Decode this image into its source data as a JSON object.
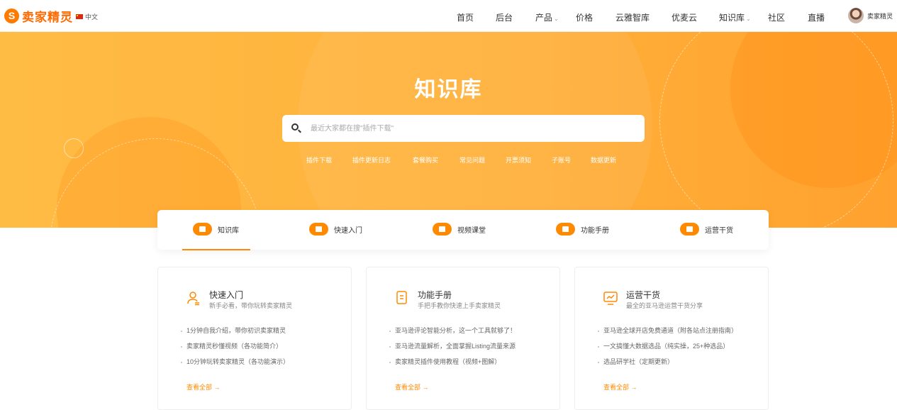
{
  "brand": {
    "logo_mark": "S",
    "name": "卖家精灵",
    "color": "#ff6a00"
  },
  "lang": {
    "label": "中文"
  },
  "nav": {
    "home": "首页",
    "backend": "后台",
    "product": "产品",
    "price": "价格",
    "yunya": "云雅智库",
    "youmai": "优麦云",
    "knowledge": "知识库",
    "community": "社区",
    "live": "直播"
  },
  "user": {
    "name": "卖家精灵"
  },
  "hero": {
    "title": "知识库",
    "search_placeholder": "最近大家都在搜\"插件下载\"",
    "hot_links": [
      "插件下载",
      "插件更新日志",
      "套餐购买",
      "常见问题",
      "开票须知",
      "子账号",
      "数据更新"
    ]
  },
  "tabs": [
    {
      "label": "知识库",
      "icon": "folder-icon"
    },
    {
      "label": "快速入门",
      "icon": "user-icon"
    },
    {
      "label": "视频课堂",
      "icon": "video-icon"
    },
    {
      "label": "功能手册",
      "icon": "document-icon"
    },
    {
      "label": "运营干货",
      "icon": "briefcase-icon"
    }
  ],
  "cards": [
    {
      "title": "快速入门",
      "subtitle": "新手必看，带你玩转卖家精灵",
      "items": [
        "1分钟自我介绍，带你初识卖家精灵",
        "卖家精灵秒懂视频（各功能简介）",
        "10分钟玩转卖家精灵（各功能演示）"
      ],
      "more": "查看全部 →"
    },
    {
      "title": "功能手册",
      "subtitle": "手把手教你快速上手卖家精灵",
      "items": [
        "亚马逊评论智能分析，这一个工具就够了！",
        "亚马逊流量解析，全面掌握Listing流量来源",
        "卖家精灵插件使用教程（视频+图解）"
      ],
      "more": "查看全部 →"
    },
    {
      "title": "运营干货",
      "subtitle": "最全的亚马逊运营干货分享",
      "items": [
        "亚马逊全球开店免费通道（附各站点注册指南）",
        "一文搞懂大数据选品（纯实操，25+种选品）",
        "选品研学社（定期更新）"
      ],
      "more": "查看全部 →"
    }
  ],
  "accent_color": "#ff8a00"
}
